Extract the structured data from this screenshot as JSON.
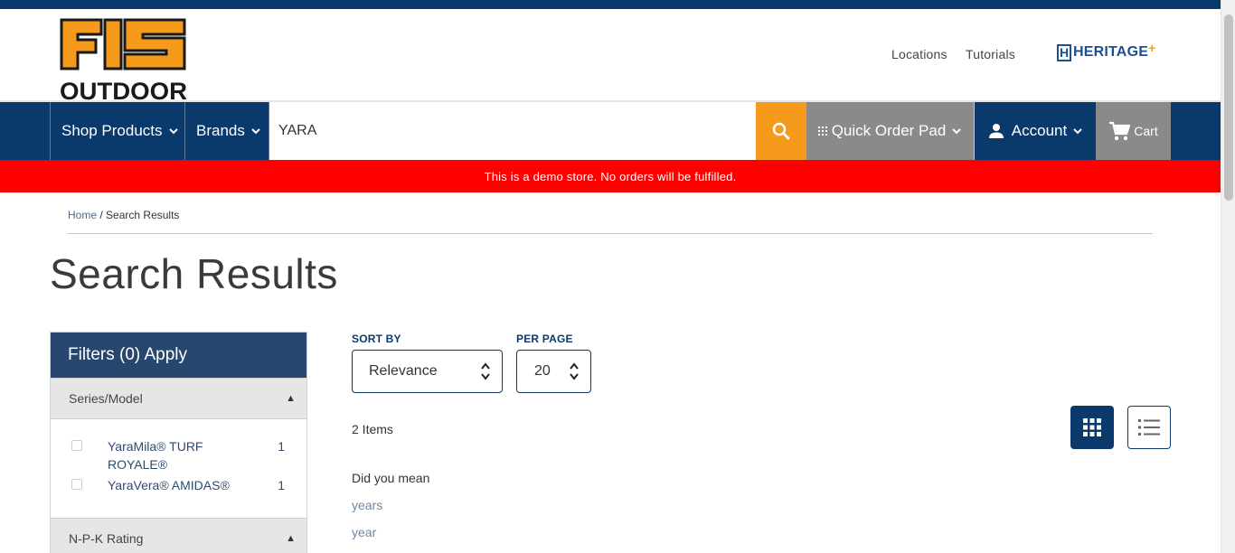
{
  "brand": {
    "logo_top": "FIS",
    "logo_bottom": "OUTDOOR",
    "colors": {
      "navy": "#0a3a6b",
      "orange": "#f59a1b",
      "red": "#ff0000",
      "gray": "#8a8a8a"
    }
  },
  "header": {
    "links": [
      "Locations",
      "Tutorials"
    ],
    "partner_logo": "HERITAGE",
    "partner_mark": "H",
    "partner_plus": "+"
  },
  "nav": {
    "shop_products": "Shop Products",
    "brands": "Brands",
    "search_value": "YARA",
    "quick_order_pad": "Quick Order Pad",
    "account": "Account",
    "cart": "Cart"
  },
  "banner": {
    "demo_notice": "This is a demo store. No orders will be fulfilled."
  },
  "breadcrumb": {
    "home": "Home",
    "separator": "/",
    "current": "Search Results"
  },
  "page": {
    "title": "Search Results"
  },
  "filters": {
    "header": "Filters (0) Apply",
    "sections": [
      {
        "title": "Series/Model",
        "expanded": true,
        "items": [
          {
            "label": "YaraMila® TURF ROYALE®",
            "count": "1"
          },
          {
            "label": "YaraVera® AMIDAS®",
            "count": "1"
          }
        ]
      },
      {
        "title": "N-P-K Rating",
        "expanded": true,
        "items": []
      }
    ]
  },
  "results": {
    "sort_label": "SORT BY",
    "sort_value": "Relevance",
    "per_page_label": "PER PAGE",
    "per_page_value": "20",
    "item_count": "2 Items",
    "did_you_mean_label": "Did you mean",
    "suggestions": [
      "years",
      "year"
    ],
    "view_mode": "grid"
  }
}
